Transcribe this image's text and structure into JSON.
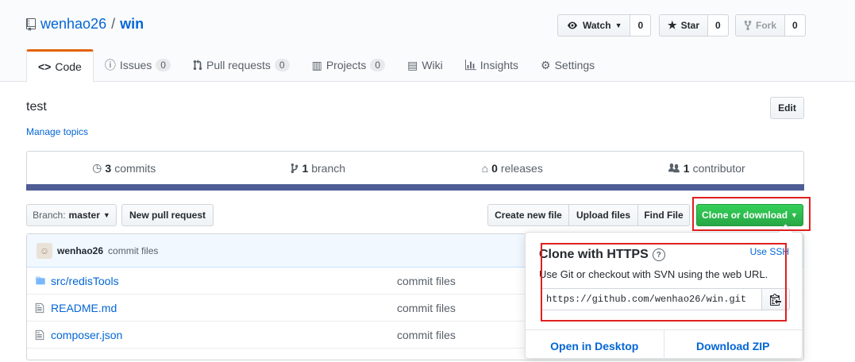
{
  "repo": {
    "owner": "wenhao26",
    "separator": "/",
    "name": "win"
  },
  "actions": {
    "watch": {
      "label": "Watch",
      "count": "0"
    },
    "star": {
      "label": "Star",
      "count": "0"
    },
    "fork": {
      "label": "Fork",
      "count": "0"
    }
  },
  "tabs": [
    {
      "label": "Code"
    },
    {
      "label": "Issues",
      "count": "0"
    },
    {
      "label": "Pull requests",
      "count": "0"
    },
    {
      "label": "Projects",
      "count": "0"
    },
    {
      "label": "Wiki"
    },
    {
      "label": "Insights"
    },
    {
      "label": "Settings"
    }
  ],
  "description": "test",
  "manage_topics": "Manage topics",
  "edit_label": "Edit",
  "summary": {
    "commits": {
      "num": "3",
      "label": "commits"
    },
    "branch": {
      "num": "1",
      "label": "branch"
    },
    "releases": {
      "num": "0",
      "label": "releases"
    },
    "contributors": {
      "num": "1",
      "label": "contributor"
    }
  },
  "language_color": "#4F5D95",
  "toolbar": {
    "branch_prefix": "Branch:",
    "branch_name": "master",
    "new_pull_request": "New pull request",
    "create_new_file": "Create new file",
    "upload_files": "Upload files",
    "find_file": "Find File",
    "clone_or_download": "Clone or download"
  },
  "latest_commit": {
    "author": "wenhao26",
    "message": "commit files"
  },
  "files": [
    {
      "type": "dir",
      "name": "src/redisTools",
      "message": "commit files"
    },
    {
      "type": "file",
      "name": "README.md",
      "message": "commit files"
    },
    {
      "type": "file",
      "name": "composer.json",
      "message": "commit files"
    }
  ],
  "clone_popup": {
    "title": "Clone with HTTPS",
    "use_ssh": "Use SSH",
    "instructions": "Use Git or checkout with SVN using the web URL.",
    "url": "https://github.com/wenhao26/win.git",
    "open_desktop": "Open in Desktop",
    "download_zip": "Download ZIP"
  },
  "highlight_color": "#e02020"
}
